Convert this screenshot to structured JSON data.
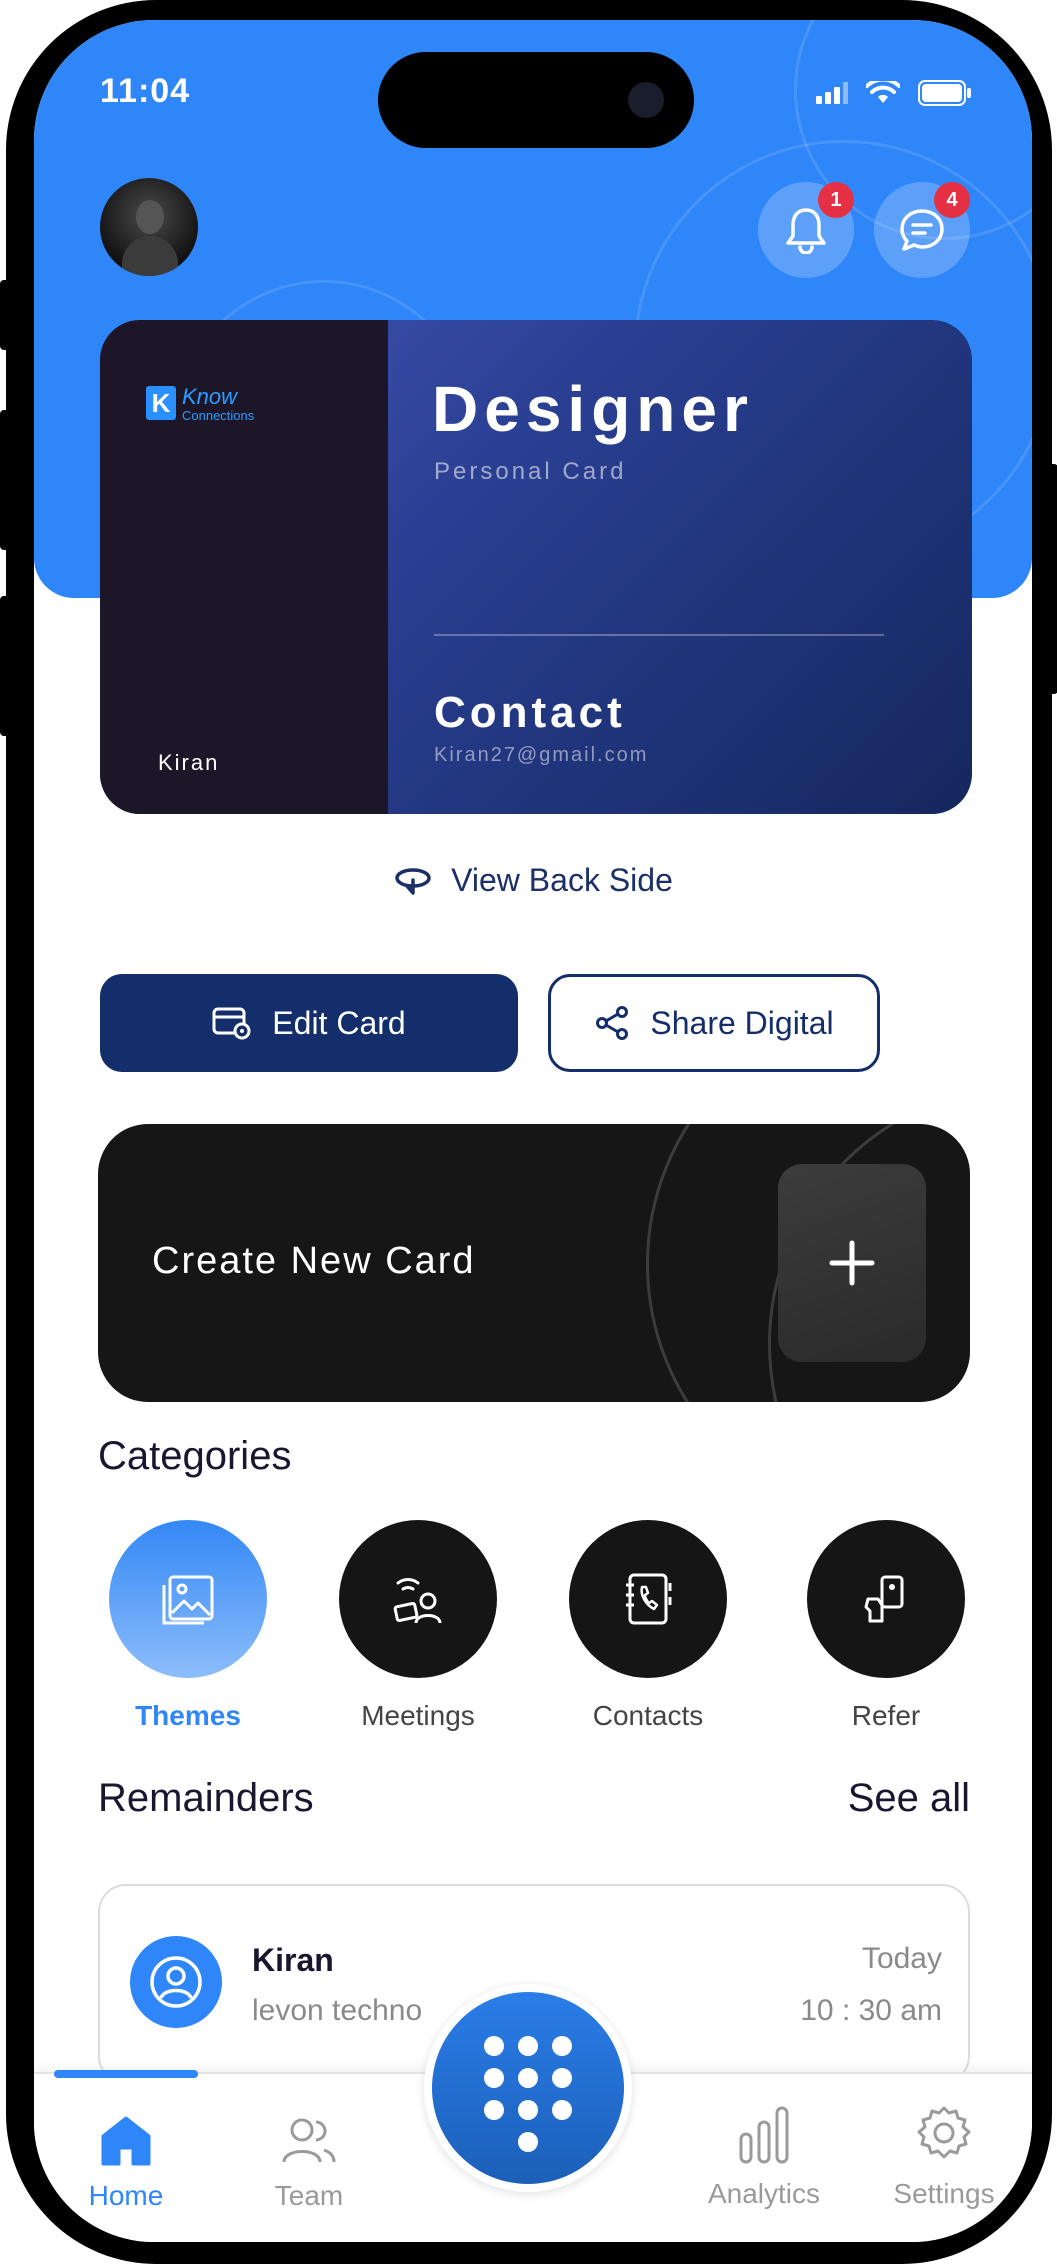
{
  "status_bar": {
    "time": "11:04"
  },
  "header": {
    "notification_count": "1",
    "message_count": "4"
  },
  "card": {
    "logo_line1": "Know",
    "logo_line2": "Connections",
    "owner_name": "Kiran",
    "title": "Designer",
    "subtitle": "Personal Card",
    "contact_heading": "Contact",
    "email": "Kiran27@gmail.com"
  },
  "actions": {
    "view_back": "View Back Side",
    "edit": "Edit Card",
    "share": "Share Digital"
  },
  "create_card": {
    "label": "Create New Card"
  },
  "categories": {
    "title": "Categories",
    "items": [
      {
        "label": "Themes",
        "icon": "image-icon",
        "active": true
      },
      {
        "label": "Meetings",
        "icon": "meeting-icon",
        "active": false
      },
      {
        "label": "Contacts",
        "icon": "contact-book-icon",
        "active": false
      },
      {
        "label": "Refer",
        "icon": "refer-icon",
        "active": false
      }
    ]
  },
  "reminders": {
    "title": "Remainders",
    "see_all": "See all",
    "items": [
      {
        "name": "Kiran",
        "company": "levon techno",
        "day": "Today",
        "time": "10 : 30 am"
      }
    ]
  },
  "tabbar": {
    "items": [
      {
        "label": "Home",
        "icon": "home-icon",
        "active": true
      },
      {
        "label": "Team",
        "icon": "team-icon",
        "active": false
      },
      {
        "label": "Analytics",
        "icon": "analytics-icon",
        "active": false
      },
      {
        "label": "Settings",
        "icon": "settings-icon",
        "active": false
      }
    ]
  },
  "colors": {
    "accent": "#2f86f8",
    "navy": "#142e6b",
    "badge": "#e53044"
  }
}
